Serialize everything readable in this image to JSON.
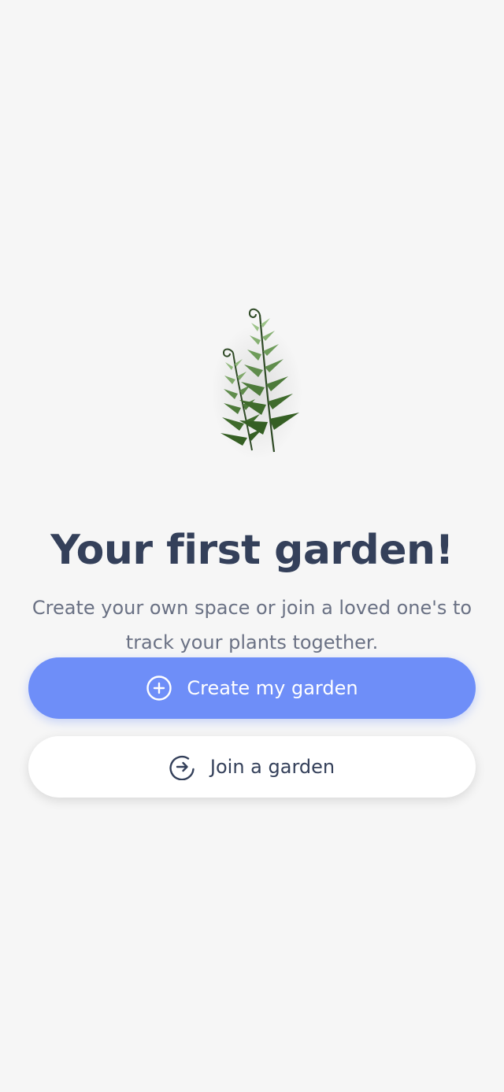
{
  "onboarding": {
    "illustration": "fern-plant-illustration",
    "title": "Your first garden!",
    "subtitle": "Create your own space or join a loved one's to track your plants together.",
    "primary_button": {
      "label": "Create my garden",
      "icon": "plus-circle-icon"
    },
    "secondary_button": {
      "label": "Join a garden",
      "icon": "arrow-right-circle-icon"
    }
  },
  "colors": {
    "background": "#f6f6f6",
    "primary": "#6e8ef8",
    "title_text": "#34405a",
    "body_text": "#6a7184",
    "fern_dark": "#3f6b2c",
    "fern_light": "#7fa86a"
  }
}
